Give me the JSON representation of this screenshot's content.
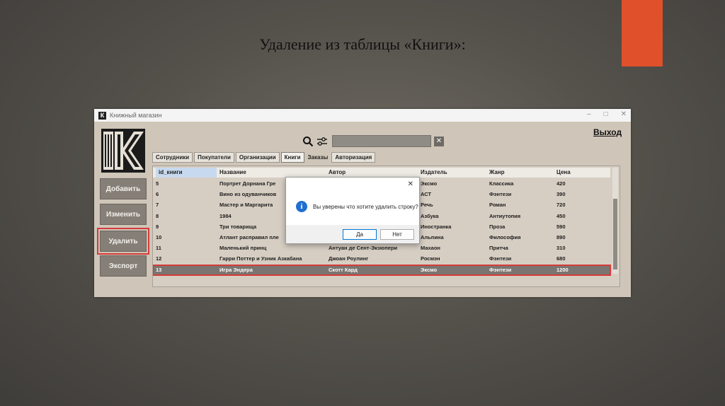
{
  "slide": {
    "title": "Удаление из таблицы «Книги»:",
    "accent_color": "#e0502a"
  },
  "window": {
    "title": "Книжный магазин",
    "app_icon_letter": "К",
    "controls": [
      "–",
      "□",
      "✕"
    ]
  },
  "header": {
    "exit_label": "Выход"
  },
  "sidebar": {
    "buttons": [
      {
        "label": "Добавить"
      },
      {
        "label": "Изменить"
      },
      {
        "label": "Удалить",
        "highlighted": true
      },
      {
        "label": "Экспорт"
      }
    ]
  },
  "search": {
    "value": "",
    "clear_label": "✕",
    "icons": [
      "search-icon",
      "filter-icon"
    ]
  },
  "tabs": [
    {
      "label": "Сотрудники"
    },
    {
      "label": "Покупатели"
    },
    {
      "label": "Организации"
    },
    {
      "label": "Книги",
      "active": true
    },
    {
      "label": "Заказы"
    },
    {
      "label": "Авторизация"
    }
  ],
  "table": {
    "columns": [
      "id_книги",
      "Название",
      "Автор",
      "Издатель",
      "Жанр",
      "Цена"
    ],
    "rows": [
      [
        "5",
        "Портрет Дорнана Гре",
        "",
        "Эксмо",
        "Классика",
        "420"
      ],
      [
        "6",
        "Вино из одуванчиков",
        "",
        "АСТ",
        "Фэнтези",
        "390"
      ],
      [
        "7",
        "Мастер и Маргарита",
        "",
        "Речь",
        "Роман",
        "720"
      ],
      [
        "8",
        "1984",
        "",
        "Азбука",
        "Антиутопия",
        "450"
      ],
      [
        "9",
        "Три товарища",
        "",
        "Иностранка",
        "Проза",
        "590"
      ],
      [
        "10",
        "Атлант расправил пле",
        "",
        "Альпина",
        "Философия",
        "890"
      ],
      [
        "11",
        "Маленький принц",
        "Антуан де Сент-Экзюпери",
        "Махаон",
        "Притча",
        "310"
      ],
      [
        "12",
        "Гарри Поттер и Узник Азкабана",
        "Джоан Роулинг",
        "Росмэн",
        "Фэнтези",
        "680"
      ],
      [
        "13",
        "Игра Эндера",
        "Скотт Кард",
        "Эксмо",
        "Фэнтези",
        "1200"
      ]
    ],
    "selected_row": 8
  },
  "dialog": {
    "close_label": "✕",
    "icon": "info-icon",
    "message": "Вы уверены что хотите удалить строку?",
    "yes_label": "Да",
    "no_label": "Нет"
  }
}
